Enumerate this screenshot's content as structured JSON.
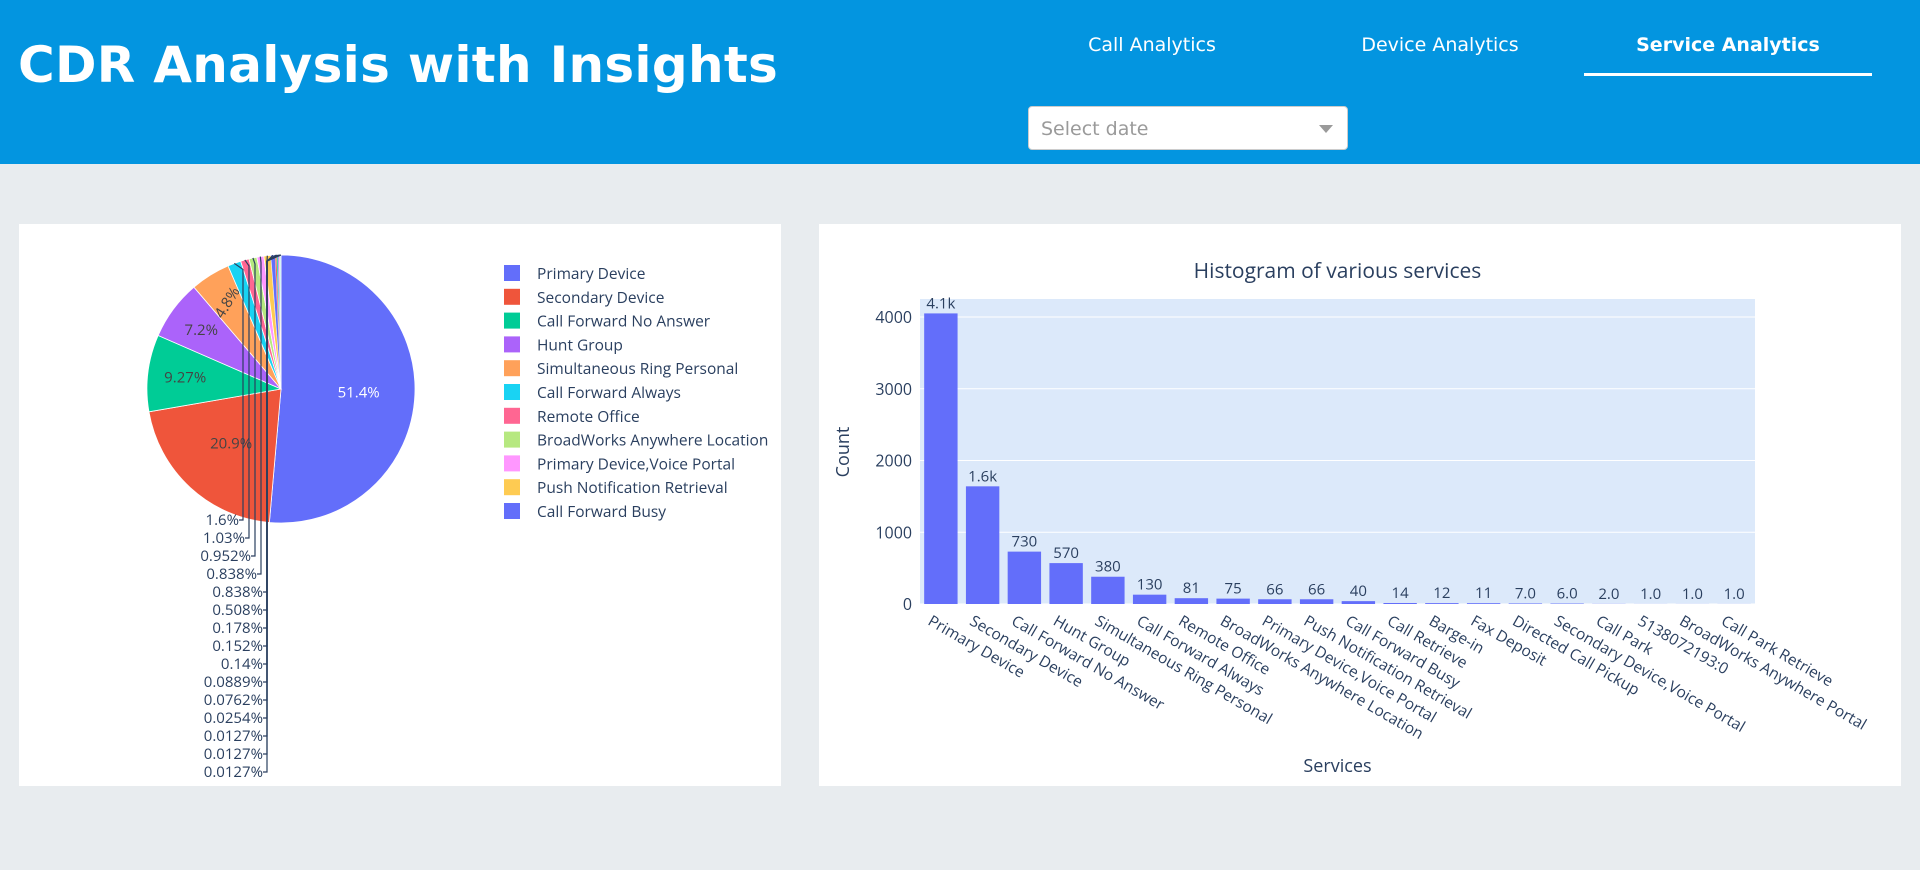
{
  "header": {
    "title": "CDR Analysis with Insights",
    "tabs": [
      {
        "label": "Call Analytics",
        "active": false
      },
      {
        "label": "Device Analytics",
        "active": false
      },
      {
        "label": "Service Analytics",
        "active": true
      }
    ],
    "date_select": {
      "placeholder": "Select date",
      "value": ""
    }
  },
  "colors": {
    "header_bg": "#0395e0",
    "page_bg": "#e8ecef",
    "plot_bg": "#dce9fa",
    "bar": "#636efa",
    "text": "#2a3f5f"
  },
  "icons": {
    "date_select": "chevron-down-icon"
  },
  "chart_data": [
    {
      "type": "pie",
      "title": "",
      "legend_position": "right",
      "slices": [
        {
          "label": "Primary Device",
          "percent": 51.4,
          "color": "#636efa"
        },
        {
          "label": "Secondary Device",
          "percent": 20.9,
          "color": "#EF553B"
        },
        {
          "label": "Call Forward No Answer",
          "percent": 9.27,
          "color": "#00cc96"
        },
        {
          "label": "Hunt Group",
          "percent": 7.2,
          "color": "#ab63fa"
        },
        {
          "label": "Simultaneous Ring Personal",
          "percent": 4.8,
          "color": "#FFA15A"
        },
        {
          "label": "Call Forward Always",
          "percent": 1.6,
          "color": "#19d3f3"
        },
        {
          "label": "Remote Office",
          "percent": 1.03,
          "color": "#FF6692"
        },
        {
          "label": "BroadWorks Anywhere Location",
          "percent": 0.952,
          "color": "#B6E880"
        },
        {
          "label": "Primary Device,Voice Portal",
          "percent": 0.838,
          "color": "#FF97FF"
        },
        {
          "label": "Push Notification Retrieval",
          "percent": 0.838,
          "color": "#FECB52"
        },
        {
          "label": "Call Forward Busy",
          "percent": 0.508,
          "color": "#636efa"
        },
        {
          "label": "",
          "percent": 0.178,
          "color": "#EF553B"
        },
        {
          "label": "",
          "percent": 0.152,
          "color": "#00cc96"
        },
        {
          "label": "",
          "percent": 0.14,
          "color": "#ab63fa"
        },
        {
          "label": "",
          "percent": 0.0889,
          "color": "#FFA15A"
        },
        {
          "label": "",
          "percent": 0.0762,
          "color": "#19d3f3"
        },
        {
          "label": "",
          "percent": 0.0254,
          "color": "#FF6692"
        },
        {
          "label": "",
          "percent": 0.0127,
          "color": "#B6E880"
        },
        {
          "label": "",
          "percent": 0.0127,
          "color": "#FF97FF"
        },
        {
          "label": "",
          "percent": 0.0127,
          "color": "#FECB52"
        }
      ],
      "slice_labels": [
        "51.4%",
        "20.9%",
        "9.27%",
        "7.2%",
        "4.8%",
        "1.6%",
        "1.03%",
        "0.952%",
        "0.838%",
        "0.838%",
        "0.508%",
        "0.178%",
        "0.152%",
        "0.14%",
        "0.0889%",
        "0.0762%",
        "0.0254%",
        "0.0127%",
        "0.0127%",
        "0.0127%"
      ],
      "legend": [
        "Primary Device",
        "Secondary Device",
        "Call Forward No Answer",
        "Hunt Group",
        "Simultaneous Ring Personal",
        "Call Forward Always",
        "Remote Office",
        "BroadWorks Anywhere Location",
        "Primary Device,Voice Portal",
        "Push Notification Retrieval",
        "Call Forward Busy"
      ]
    },
    {
      "type": "bar",
      "title": "Histogram of various services",
      "xlabel": "Services",
      "ylabel": "Count",
      "ylim": [
        0,
        4000
      ],
      "yticks": [
        0,
        1000,
        2000,
        3000,
        4000
      ],
      "grid": true,
      "categories": [
        "Primary Device",
        "Secondary Device",
        "Call Forward No Answer",
        "Hunt Group",
        "Simultaneous Ring Personal",
        "Call Forward Always",
        "Remote Office",
        "BroadWorks Anywhere Location",
        "Primary Device,Voice Portal",
        "Push Notification Retrieval",
        "Call Forward Busy",
        "Call Retrieve",
        "Barge-in",
        "Fax Deposit",
        "Directed Call Pickup",
        "Secondary Device,Voice Portal",
        "Call Park",
        "5138072193:0",
        "BroadWorks Anywhere Portal",
        "Call Park Retrieve"
      ],
      "values": [
        4050,
        1640,
        730,
        570,
        380,
        130,
        81,
        75,
        66,
        66,
        40,
        14,
        12,
        11,
        7,
        6,
        2,
        1,
        1,
        1
      ],
      "value_labels": [
        "4.1k",
        "1.6k",
        "730",
        "570",
        "380",
        "130",
        "81",
        "75",
        "66",
        "66",
        "40",
        "14",
        "12",
        "11",
        "7.0",
        "6.0",
        "2.0",
        "1.0",
        "1.0",
        "1.0"
      ]
    }
  ]
}
